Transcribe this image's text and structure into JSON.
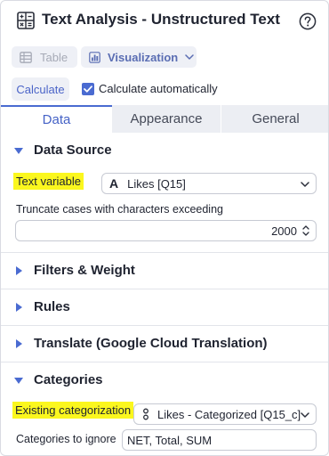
{
  "header": {
    "title": "Text Analysis - Unstructured Text",
    "app_icon": "calculator-icon",
    "help_icon": "help-circle-icon"
  },
  "toolbar": {
    "table_label": "Table",
    "visualization_label": "Visualization",
    "calculate_label": "Calculate",
    "auto_calc_label": "Calculate automatically",
    "auto_calc_checked": true
  },
  "tabs": [
    {
      "label": "Data",
      "active": true
    },
    {
      "label": "Appearance",
      "active": false
    },
    {
      "label": "General",
      "active": false
    }
  ],
  "data_source": {
    "title": "Data Source",
    "text_variable_label": "Text variable",
    "text_variable_value": "Likes [Q15]",
    "text_variable_icon": "text-type-icon",
    "truncate_label": "Truncate cases with characters exceeding",
    "truncate_value": "2000"
  },
  "sections": {
    "filters": "Filters & Weight",
    "rules": "Rules",
    "translate": "Translate (Google Cloud Translation)"
  },
  "categories": {
    "title": "Categories",
    "existing_label": "Existing categorization",
    "existing_value": "Likes - Categorized [Q15_c]",
    "existing_icon": "categorical-icon",
    "ignore_label": "Categories to ignore",
    "ignore_value": "NET, Total, SUM"
  },
  "colors": {
    "accent": "#4a6bd1",
    "highlight": "#fbf71e",
    "tab_bg": "#eceef3"
  }
}
